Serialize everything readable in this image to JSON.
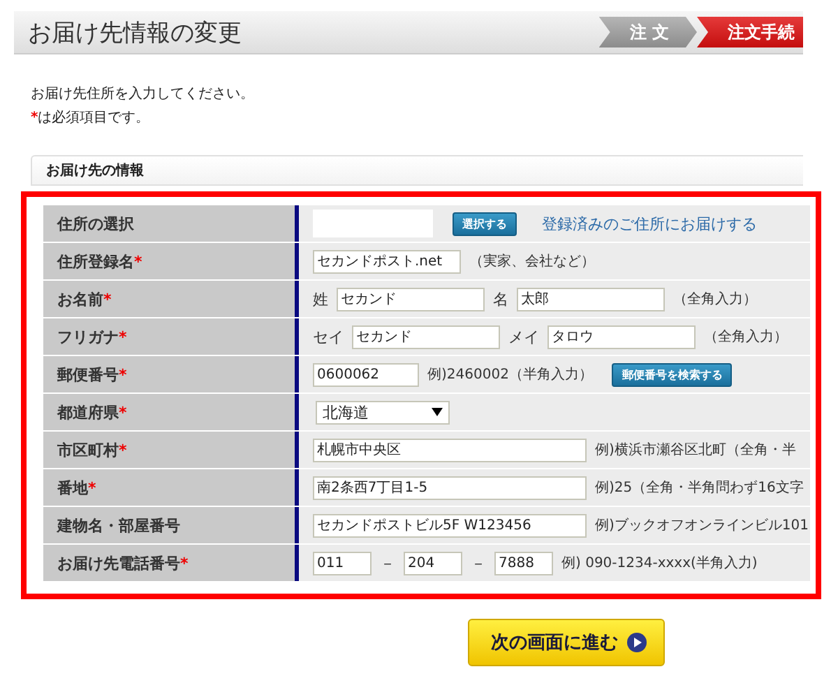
{
  "header": {
    "title": "お届け先情報の変更",
    "steps": [
      {
        "label": "注 文",
        "selected": false
      },
      {
        "label": "注文手続",
        "selected": true
      }
    ]
  },
  "intro": {
    "line": "お届け先住所を入力してください。",
    "mark": "*",
    "required_note": "は必須項目です。"
  },
  "section_title": "お届け先の情報",
  "rows": [
    {
      "label": "住所の選択",
      "items": [
        {
          "kind": "blank"
        },
        {
          "kind": "button",
          "text": "選択する"
        },
        {
          "kind": "link",
          "text": "登録済みのご住所にお届けする"
        }
      ]
    },
    {
      "label": "住所登録名",
      "mark": "*",
      "items": [
        {
          "kind": "input",
          "value": "セカンドポスト.net"
        },
        {
          "kind": "note",
          "text": "（実家、会社など）"
        }
      ]
    },
    {
      "label": "お名前",
      "mark": "*",
      "items": [
        {
          "kind": "label",
          "text": "姓"
        },
        {
          "kind": "input",
          "value": "セカンド"
        },
        {
          "kind": "label",
          "text": "名"
        },
        {
          "kind": "input",
          "value": "太郎"
        },
        {
          "kind": "note",
          "text": "（全角入力）"
        }
      ]
    },
    {
      "label": "フリガナ",
      "mark": "*",
      "items": [
        {
          "kind": "label",
          "text": "セイ"
        },
        {
          "kind": "input",
          "value": "セカンド"
        },
        {
          "kind": "label",
          "text": "メイ"
        },
        {
          "kind": "input",
          "value": "タロウ"
        },
        {
          "kind": "note",
          "text": "（全角入力）"
        }
      ]
    },
    {
      "label": "郵便番号",
      "mark": "*",
      "items": [
        {
          "kind": "short_input",
          "value": "0600062"
        },
        {
          "kind": "note",
          "text": "例)2460002（半角入力）"
        },
        {
          "kind": "button",
          "text": "郵便番号を検索する"
        }
      ]
    },
    {
      "label": "都道府県",
      "mark": "*",
      "items": [
        {
          "kind": "select",
          "value": "北海道"
        }
      ]
    },
    {
      "label": "市区町村",
      "mark": "*",
      "items": [
        {
          "kind": "wide_input",
          "value": "札幌市中央区"
        },
        {
          "kind": "note",
          "text": "例)横浜市瀬谷区北町（全角・半"
        }
      ]
    },
    {
      "label": "番地",
      "mark": "*",
      "items": [
        {
          "kind": "wide_input",
          "value": "南2条西7丁目1-5"
        },
        {
          "kind": "note",
          "text": "例)25（全角・半角問わず16文字"
        }
      ]
    },
    {
      "label": "建物名・部屋番号",
      "items": [
        {
          "kind": "wide_input",
          "value": "セカンドポストビル5F W123456"
        },
        {
          "kind": "note",
          "text": "例)ブックオフオンラインビル101"
        }
      ]
    },
    {
      "label": "お届け先電話番号",
      "mark": "*",
      "items": [
        {
          "kind": "tiny_input",
          "value": "011"
        },
        {
          "kind": "label",
          "text": "－"
        },
        {
          "kind": "tiny_input",
          "value": "204"
        },
        {
          "kind": "label",
          "text": "－"
        },
        {
          "kind": "tiny_input",
          "value": "7888"
        },
        {
          "kind": "note",
          "text": "例) 090-1234-xxxx(半角入力)"
        }
      ]
    }
  ],
  "next_button": "次の画面に進む"
}
